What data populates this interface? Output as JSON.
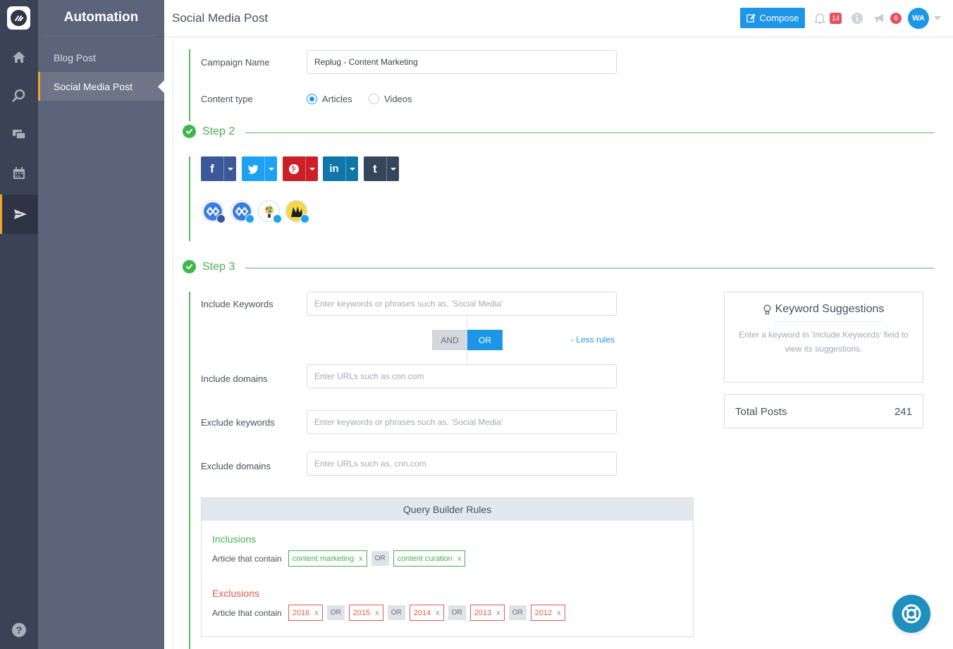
{
  "sidebar": {
    "title": "Automation",
    "items": [
      {
        "label": "Blog Post"
      },
      {
        "label": "Social Media Post"
      }
    ]
  },
  "rail": {
    "icons": [
      "home-icon",
      "search-icon",
      "chat-icon",
      "calendar-icon",
      "send-icon"
    ],
    "active": "send-icon",
    "help": "?"
  },
  "header": {
    "title": "Social Media Post",
    "compose_label": "Compose",
    "notifications_count": "14",
    "announcements_count": "6",
    "avatar_initials": "WA"
  },
  "step1": {
    "campaign_label": "Campaign Name",
    "campaign_value": "Replug - Content Marketing",
    "content_type_label": "Content type",
    "content_types": [
      "Articles",
      "Videos"
    ],
    "selected_content_type": "Articles"
  },
  "step2": {
    "title": "Step 2",
    "networks": [
      "facebook",
      "twitter",
      "pinterest",
      "linkedin",
      "tumblr"
    ]
  },
  "step3": {
    "title": "Step 3",
    "include_keywords_label": "Include Keywords",
    "include_keywords_placeholder": "Enter keywords or phrases such as, 'Social Media'",
    "and_label": "AND",
    "or_label": "OR",
    "less_rules_label": "- Less rules",
    "include_domains_label": "Include domains",
    "include_domains_placeholder": "Enter URLs such as cnn.com",
    "exclude_keywords_label": "Exclude keywords",
    "exclude_keywords_placeholder": "Enter keywords or phrases such as, 'Social Media'",
    "exclude_domains_label": "Exclude domains",
    "exclude_domains_placeholder": "Enter URLs such as, cnn.com"
  },
  "query_builder": {
    "title": "Query Builder Rules",
    "inclusions_title": "Inclusions",
    "exclusions_title": "Exclusions",
    "row_label": "Article that contain",
    "or_label": "OR",
    "inclusions": [
      "content marketing",
      "content curation"
    ],
    "exclusions": [
      "2016",
      "2015",
      "2014",
      "2013",
      "2012"
    ],
    "remove_label": "x"
  },
  "suggestions": {
    "title": "Keyword Suggestions",
    "hint": "Enter a keyword in 'Include Keywords' field to view its suggestions."
  },
  "total_posts": {
    "label": "Total Posts",
    "value": "241"
  },
  "colors": {
    "accent": "#1e96e8",
    "success": "#4cae57",
    "danger": "#e15a52",
    "rail": "#3a4256",
    "sidebar": "#5c6479",
    "highlight": "#f5a623"
  }
}
